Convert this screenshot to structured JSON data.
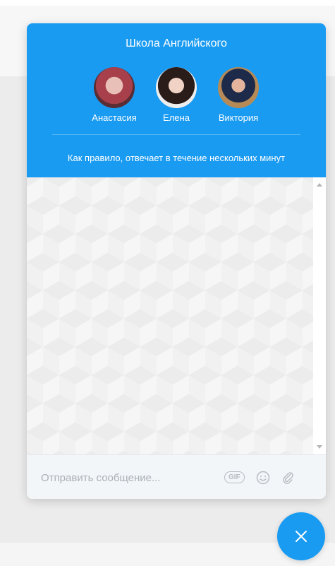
{
  "header": {
    "title": "Школа Английского",
    "agents": [
      {
        "name": "Анастасия"
      },
      {
        "name": "Елена"
      },
      {
        "name": "Виктория"
      }
    ],
    "reply_time": "Как правило, отвечает в течение нескольких минут"
  },
  "composer": {
    "placeholder": "Отправить сообщение...",
    "gif_label": "GIF",
    "icons": [
      "gif-icon",
      "smile-icon",
      "paperclip-icon"
    ]
  },
  "colors": {
    "accent": "#1a9bf2",
    "composer_bg": "#f3f6f8"
  },
  "close_button": {
    "icon": "close-icon"
  }
}
